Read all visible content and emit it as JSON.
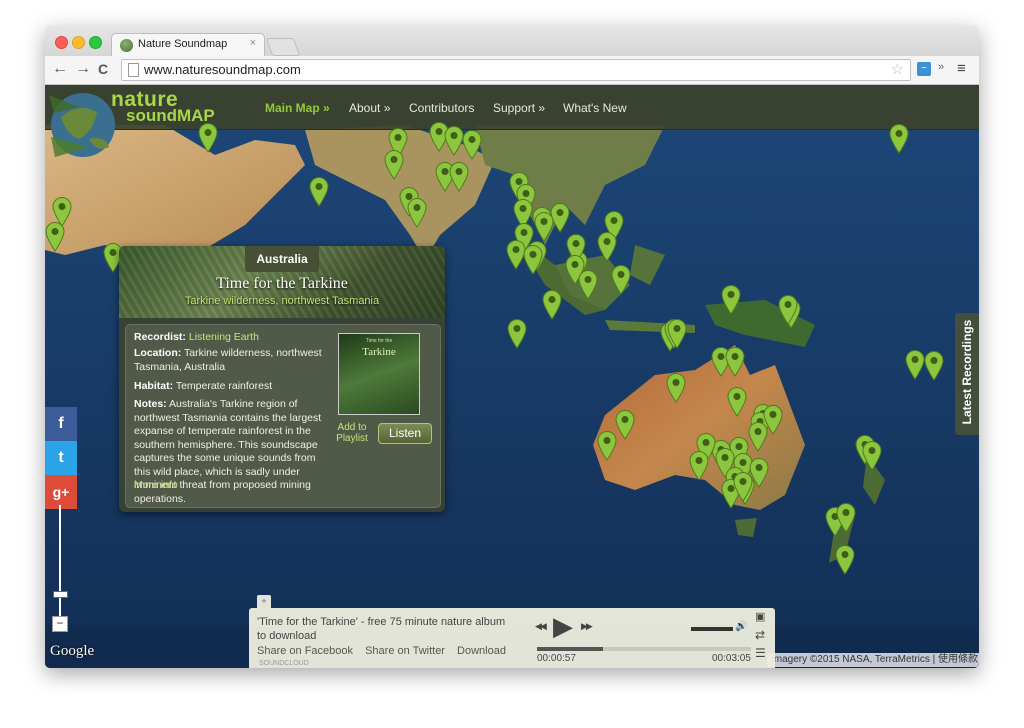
{
  "browser": {
    "tab_title": "Nature Soundmap",
    "url": "www.naturesoundmap.com",
    "close_glyph": "×",
    "back_glyph": "←",
    "forward_glyph": "→",
    "reload_glyph": "C",
    "star_glyph": "☆",
    "ext_glyph": "»",
    "menu_glyph": "≡"
  },
  "site": {
    "logo_line1": "nature",
    "logo_line2": "soundMAP",
    "nav": [
      {
        "label": "Main Map »",
        "active": true
      },
      {
        "label": "About »"
      },
      {
        "label": "Contributors"
      },
      {
        "label": "Support »"
      },
      {
        "label": "What's New"
      }
    ]
  },
  "panel": {
    "region": "Australia",
    "title": "Time for the Tarkine",
    "subtitle": "Tarkine wilderness, northwest Tasmania",
    "recordist_label": "Recordist:",
    "recordist": "Listening Earth",
    "location_label": "Location:",
    "location": "Tarkine wilderness, northwest Tasmania, Australia",
    "habitat_label": "Habitat:",
    "habitat": "Temperate rainforest",
    "notes_label": "Notes:",
    "notes": "Australia's Tarkine region of northwest Tasmania contains the largest expanse of temperate rainforest in the southern hemisphere. This soundscape captures the some unique sounds from this wild place, which is sadly under imminent threat from proposed mining operations.",
    "more_info": "More info",
    "album_title": "Tarkine",
    "album_sub": "Time for the",
    "add_to_playlist": "Add to Playlist",
    "listen": "Listen"
  },
  "social": {
    "facebook": "f",
    "twitter": "t",
    "googleplus": "g+",
    "colors": {
      "facebook": "#3b5b99",
      "twitter": "#2aa4e6",
      "googleplus": "#dd4b39"
    }
  },
  "map": {
    "google": "Google",
    "copyright": "Imagery ©2015 NASA, TerraMetrics  |  使用條款",
    "latest_recordings": "Latest Recordings",
    "zoom_out": "−",
    "pin_color": "#8cc63f"
  },
  "player": {
    "expand": "+",
    "track": "'Time for the Tarkine' - free 75 minute nature album to download",
    "share_facebook": "Share on Facebook",
    "share_twitter": "Share on Twitter",
    "download": "Download",
    "soundcloud": "SOUNDCLOUD",
    "elapsed": "00:00:57",
    "duration": "00:03:05",
    "progress_fraction": 0.31,
    "rewind_glyph": "◀◀",
    "play_glyph": "▶",
    "ffwd_glyph": "▶▶",
    "volume_glyph": "🔊",
    "shuffle_glyph": "⇄",
    "list_glyph": "☰",
    "window_glyph": "▣"
  }
}
